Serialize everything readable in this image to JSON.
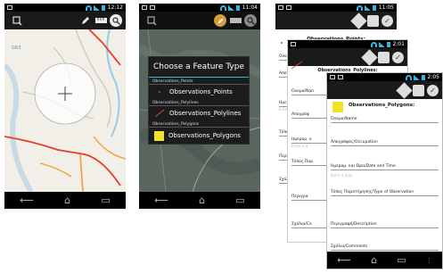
{
  "screen1": {
    "status_time": "12:12",
    "map_label": "GR3"
  },
  "screen2": {
    "status_time": "11:04",
    "dialog": {
      "title": "Choose a Feature Type",
      "groups": [
        {
          "name": "Observations_Points",
          "item": "Observations_Points",
          "icon": "point-icon"
        },
        {
          "name": "Observations_Polylines",
          "item": "Observations_Polylines",
          "icon": "polyline-icon"
        },
        {
          "name": "Observations_Polygons",
          "item": "Observations_Polygons",
          "icon": "polygon-icon"
        }
      ]
    }
  },
  "screen3": {
    "status_time": "11:05",
    "points_form": {
      "title": "Observations_Points:",
      "fields": [
        "Ονομα/Nam",
        "Απογράψ",
        "Ημερομ. κα",
        "Enter a date",
        "Τύπος Παρ",
        "Περιγραφή",
        "Σχόλια/Con"
      ]
    },
    "polylines_form": {
      "status_time": "2:01",
      "title": "Observations_Polylines:",
      "fields": [
        "Ονομα/Nan",
        "Απογράφ",
        "Ημερομ. κ",
        "Enter a d",
        "Τύπος Παρ",
        "Περιγρα",
        "Σχόλια/Co"
      ]
    },
    "polygons_form": {
      "status_time": "2:05",
      "title": "Observations_Polygons:",
      "fields": [
        {
          "label": "Όνομα/Name",
          "placeholder": ""
        },
        {
          "label": "Απογράψας/Occupation",
          "placeholder": ""
        },
        {
          "label": "Ημερομ. και Ώρα/Date and Time",
          "placeholder": "Enter a date"
        },
        {
          "label": "Τύπος Παρατήρησης/Type of Observation",
          "placeholder": ""
        },
        {
          "label": "Περιγραφή/Description",
          "placeholder": ""
        },
        {
          "label": "Σχόλια/Comments",
          "placeholder": ""
        }
      ]
    }
  },
  "colors": {
    "accent": "#33b5e5",
    "polygon_fill": "#f2e32a",
    "road_red": "#e2402a",
    "road_orange": "#f0a030"
  }
}
